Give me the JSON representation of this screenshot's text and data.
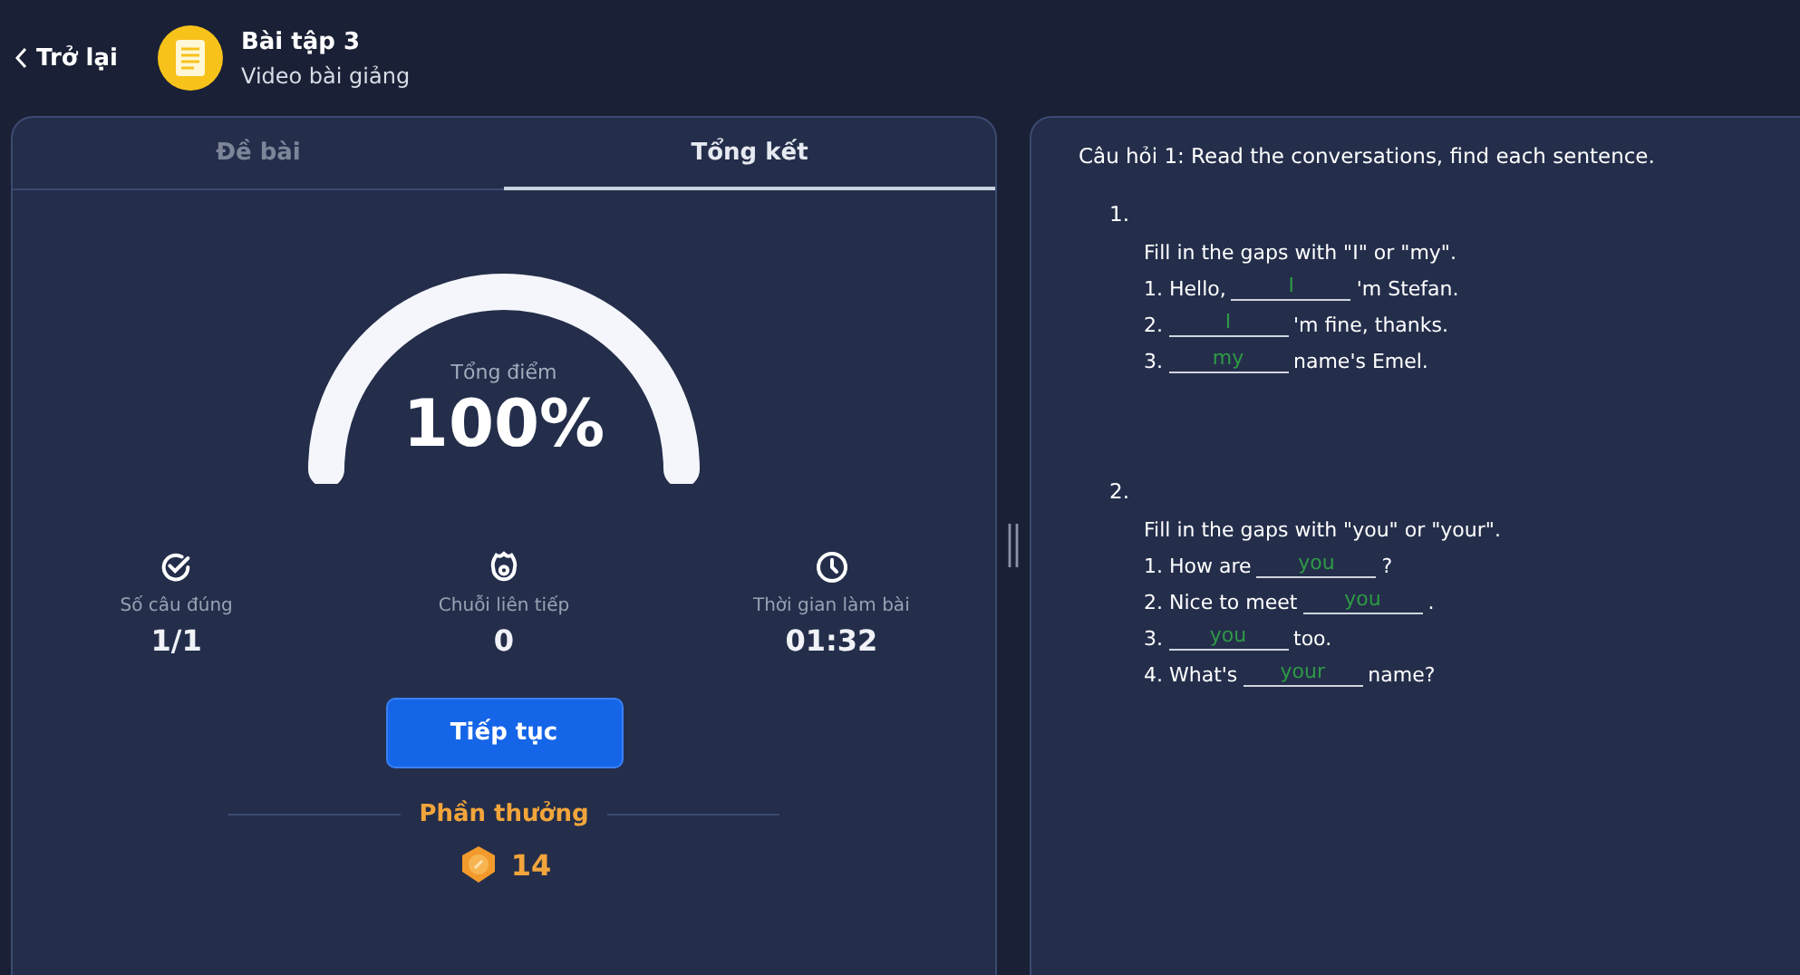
{
  "header": {
    "back": "Trở lại",
    "title": "Bài tập 3",
    "subtitle": "Video bài giảng"
  },
  "tabs": [
    {
      "label": "Đề bài",
      "selected": false
    },
    {
      "label": "Tổng kết",
      "selected": true
    }
  ],
  "score": {
    "label": "Tổng điểm",
    "value": "100%"
  },
  "stats": [
    {
      "kind": "check",
      "label": "Số câu đúng",
      "value": "1/1"
    },
    {
      "kind": "streak",
      "label": "Chuỗi liên tiếp",
      "value": "0"
    },
    {
      "kind": "clock",
      "label": "Thời gian làm bài",
      "value": "01:32"
    }
  ],
  "continue_button": "Tiếp tục",
  "reward": {
    "title": "Phần thưởng",
    "amount": "14"
  },
  "question": {
    "title": "Câu hỏi 1: Read the conversations, find each sentence.",
    "parts": [
      {
        "number": "1.",
        "instruction": "Fill in the gaps with \"I\" or \"my\".",
        "lines": [
          {
            "before": "1. Hello,",
            "answer": "I",
            "after": "'m Stefan."
          },
          {
            "before": "2.",
            "answer": "I",
            "after": "'m fine, thanks."
          },
          {
            "before": "3.",
            "answer": "my",
            "after": "name's Emel."
          }
        ]
      },
      {
        "number": "2.",
        "instruction": "Fill in the gaps with \"you\" or \"your\".",
        "lines": [
          {
            "before": "1. How are",
            "answer": "you",
            "after": "?"
          },
          {
            "before": "2. Nice to meet",
            "answer": "you",
            "after": "."
          },
          {
            "before": "3.",
            "answer": "you",
            "after": "too."
          },
          {
            "before": "4. What's",
            "answer": "your",
            "after": "name?"
          }
        ]
      }
    ]
  }
}
